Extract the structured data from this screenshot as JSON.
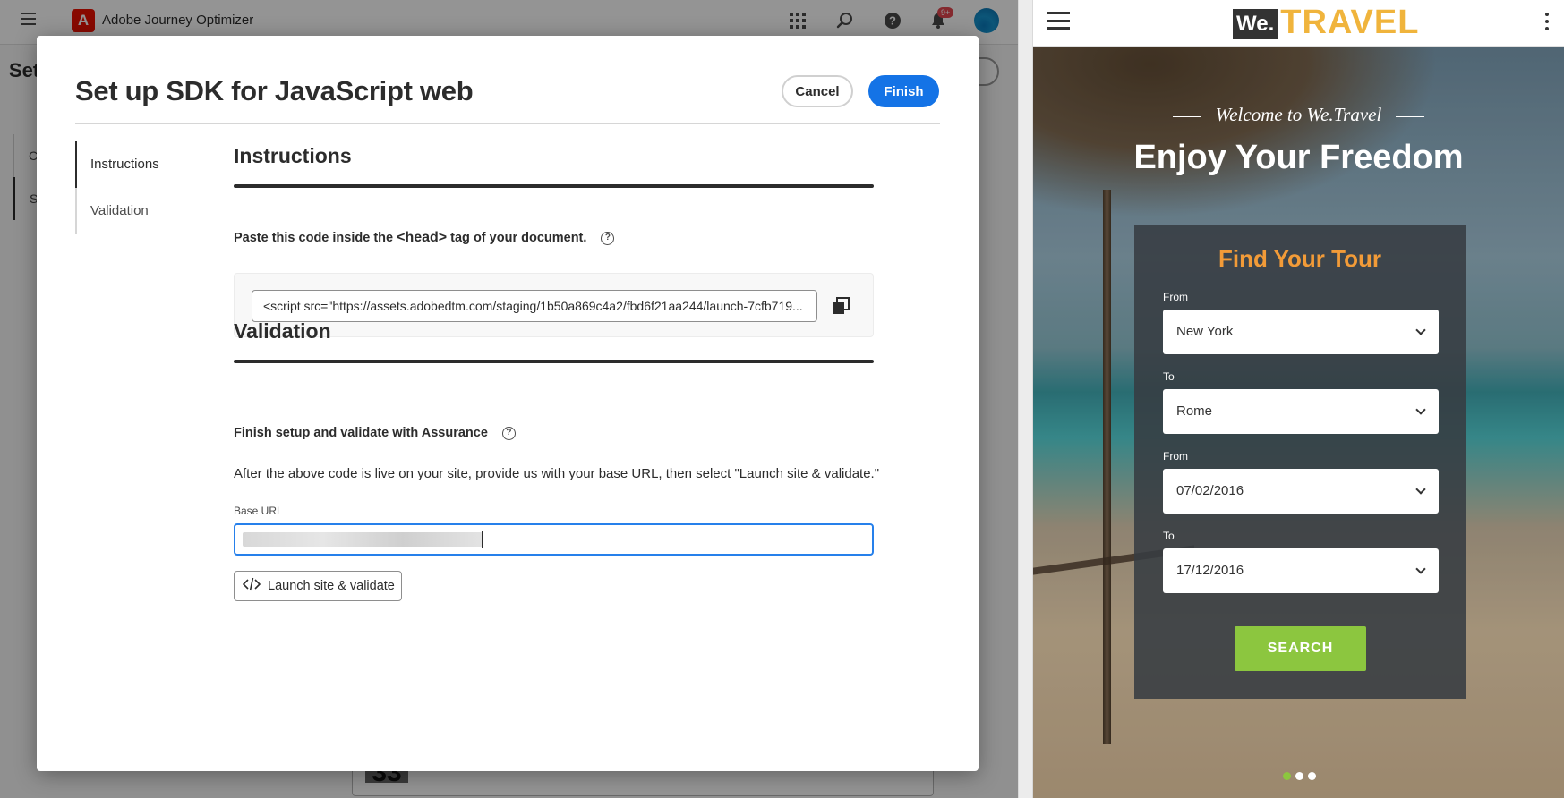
{
  "app": {
    "name": "Adobe Journey Optimizer",
    "logo_letter": "A",
    "notification_count": "9+",
    "page_title_partial": "Set",
    "bg_nav": [
      "Co",
      "SD"
    ],
    "bg_card_glyph": "33"
  },
  "modal": {
    "title": "Set up SDK for JavaScript web",
    "cancel_label": "Cancel",
    "finish_label": "Finish",
    "steps": [
      {
        "label": "Instructions",
        "active": true
      },
      {
        "label": "Validation",
        "active": false
      }
    ],
    "instructions": {
      "heading": "Instructions",
      "paste_prefix": "Paste this code inside the ",
      "paste_tag": "<head>",
      "paste_suffix": " tag of your document.",
      "code": "<script src=\"https://assets.adobedtm.com/staging/1b50a869c4a2/fbd6f21aa244/launch-7cfb719..."
    },
    "validation": {
      "heading": "Validation",
      "sub_heading": "Finish setup and validate with Assurance",
      "description": "After the above code is live on your site, provide us with your base URL, then select \"Launch site & validate.\"",
      "base_url_label": "Base URL",
      "launch_label": "Launch site & validate"
    }
  },
  "site": {
    "logo_we": "We.",
    "logo_travel": "TRAVEL",
    "welcome": "Welcome to We.Travel",
    "hero_title": "Enjoy Your Freedom",
    "panel_title": "Find Your Tour",
    "fields": [
      {
        "label": "From",
        "value": "New York"
      },
      {
        "label": "To",
        "value": "Rome"
      },
      {
        "label": "From",
        "value": "07/02/2016"
      },
      {
        "label": "To",
        "value": "17/12/2016"
      }
    ],
    "search_label": "SEARCH",
    "carousel_active_index": 0,
    "carousel_count": 3
  },
  "colors": {
    "accent_blue": "#1473e6",
    "adobe_red": "#eb1000",
    "site_orange": "#f29b38",
    "site_green": "#8cc63f",
    "logo_yellow": "#f0b43c"
  }
}
